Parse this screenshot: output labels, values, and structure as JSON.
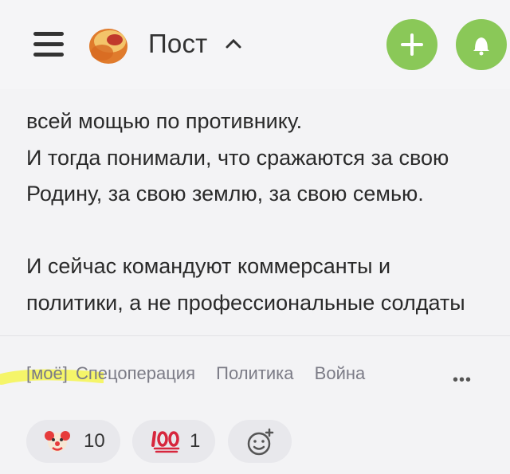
{
  "header": {
    "title": "Пост"
  },
  "article": {
    "lines_top": [
      "всей мощью по противнику.",
      "И тогда понимали, что сражаются за свою",
      "Родину, за свою землю, за свою семью."
    ],
    "lines_bottom": [
      "И сейчас командуют коммерсанты и",
      "политики, а не профессиональные солдаты"
    ]
  },
  "tags": [
    "[моё]",
    "Спецоперация",
    "Политика",
    "Война"
  ],
  "more_label": "•••",
  "reactions": [
    {
      "icon": "clown-icon",
      "count": "10"
    },
    {
      "icon": "hundred-points-icon",
      "count": "1"
    },
    {
      "icon": "add-reaction-icon"
    }
  ],
  "colors": {
    "accent_green": "#8ac858",
    "highlighter": "#f6f53a",
    "tag_text": "#7b7b86"
  }
}
